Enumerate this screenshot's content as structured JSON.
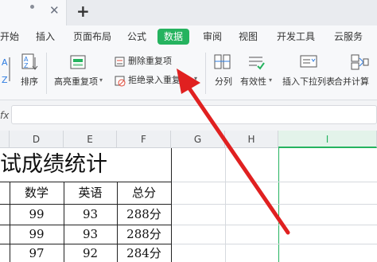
{
  "tabs": {
    "new_tab": "+",
    "close": "✕"
  },
  "menu": [
    "开始",
    "插入",
    "页面布局",
    "公式",
    "数据",
    "审阅",
    "视图",
    "开发工具",
    "云服务"
  ],
  "ribbon": {
    "sort_label": "排序",
    "highlight_dup_label": "高亮重复项",
    "remove_dup_label": "删除重复项",
    "reject_dup_label": "拒绝录入重复项",
    "split_label": "分列",
    "validity_label": "有效性",
    "insert_dropdown_label": "插入下拉列表",
    "merge_calc_label": "合并计算"
  },
  "formula_bar": {
    "fx": "fx",
    "value": ""
  },
  "columns": [
    "D",
    "E",
    "F",
    "G",
    "H",
    "I"
  ],
  "sheet": {
    "title_fragment": "试成绩统计",
    "headers": [
      "数学",
      "英语",
      "总分"
    ],
    "rows": [
      [
        "99",
        "93",
        "288分"
      ],
      [
        "99",
        "93",
        "288分"
      ],
      [
        "97",
        "92",
        "284分"
      ]
    ]
  },
  "colors": {
    "accent": "#25b35f",
    "arrow": "#e02020"
  }
}
